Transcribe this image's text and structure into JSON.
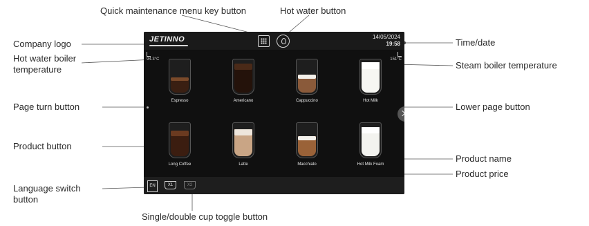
{
  "callouts": {
    "menu_key": "Quick maintenance menu key button",
    "hot_water_btn": "Hot water button",
    "logo": "Company logo",
    "hw_temp": "Hot water boiler temperature",
    "time_date": "Time/date",
    "steam_temp": "Steam boiler temperature",
    "page_turn": "Page turn button",
    "lower_page": "Lower page button",
    "product_btn": "Product button",
    "product_name": "Product name",
    "product_price": "Product price",
    "language": "Language switch button",
    "cup_toggle": "Single/double cup toggle button"
  },
  "screen": {
    "logo": "JETINNO",
    "date": "14/05/2024",
    "time": "19:58",
    "hw_temp": "94.3°C",
    "steam_temp": "151°C",
    "language": "EN",
    "cup_single": "X1",
    "cup_double": "X2",
    "products": [
      {
        "name": "Espresso",
        "price": "",
        "fill": "#3a1f12",
        "level": 0.45,
        "foam": "#7a4a2a"
      },
      {
        "name": "Americano",
        "price": "",
        "fill": "#24120a",
        "level": 0.88,
        "foam": "#4a2a18"
      },
      {
        "name": "Cappuccino",
        "price": "",
        "fill": "#8a5a3a",
        "level": 0.55,
        "foam": "#f3f0ea"
      },
      {
        "name": "Hot Milk",
        "price": "",
        "fill": "#f6f6f2",
        "level": 0.92,
        "foam": "#ffffff"
      },
      {
        "name": "Long Coffee",
        "price": "",
        "fill": "#3b1d10",
        "level": 0.78,
        "foam": "#6b3a20"
      },
      {
        "name": "Latte",
        "price": "",
        "fill": "#c9a585",
        "level": 0.82,
        "foam": "#eee6dc"
      },
      {
        "name": "Macchiato",
        "price": "",
        "fill": "#9a6238",
        "level": 0.6,
        "foam": "#f4f1ec"
      },
      {
        "name": "Hot Milk Foam",
        "price": "",
        "fill": "#f3f3ef",
        "level": 0.88,
        "foam": "#ffffff"
      }
    ]
  }
}
